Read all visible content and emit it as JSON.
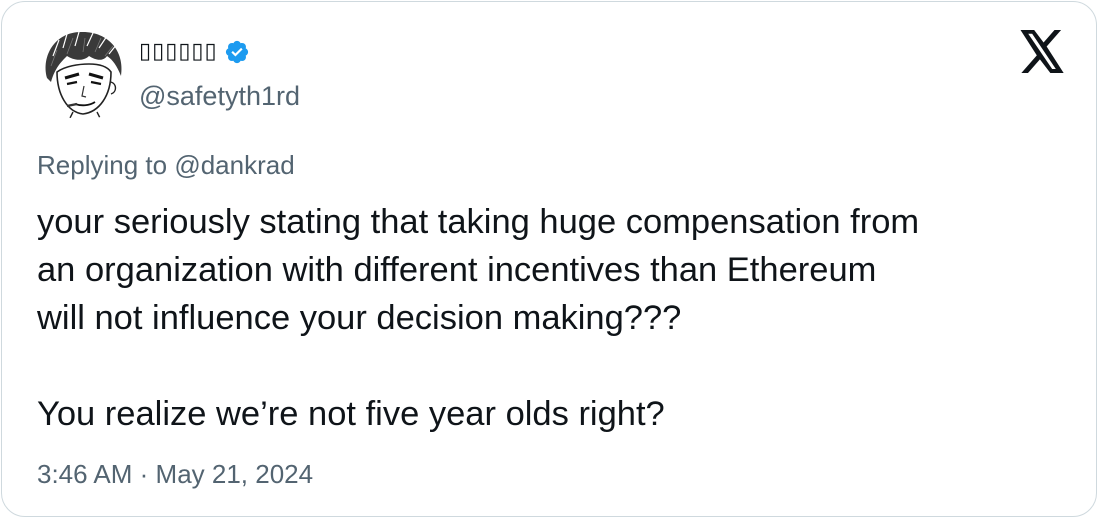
{
  "author": {
    "display_name": "▯▯▯▯▯▯",
    "handle": "@safetyth1rd",
    "verified": true,
    "avatar_icon": "anime-portrait-avatar"
  },
  "brand": {
    "logo_icon": "x-logo-icon"
  },
  "reply": {
    "prefix": "Replying to",
    "mention": "@dankrad"
  },
  "tweet": {
    "lines": [
      "your seriously stating that taking huge compensation from",
      "an organization with different incentives than Ethereum",
      "will not influence your decision making???",
      "",
      "You realize we’re not five year olds right?"
    ]
  },
  "meta": {
    "time": "3:46 AM",
    "separator": "·",
    "date": "May 21, 2024"
  },
  "colors": {
    "verified_blue": "#1d9bf0",
    "text_primary": "#0f1419",
    "text_secondary": "#536471",
    "border": "#cfd9de"
  }
}
